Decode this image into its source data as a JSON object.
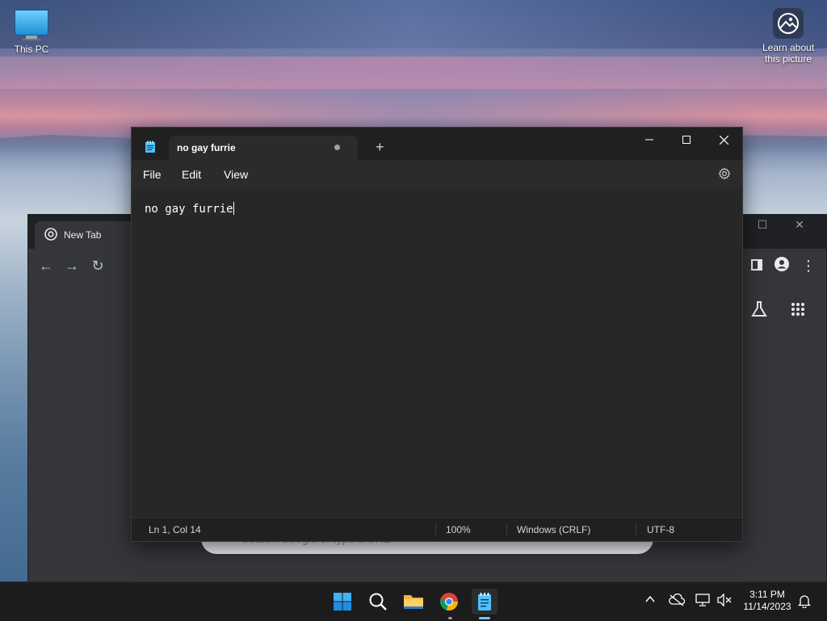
{
  "desktop": {
    "icons": [
      {
        "label": "This PC",
        "icon": "computer-icon"
      },
      {
        "label": "Learn about\nthis picture",
        "icon": "spotlight-icon"
      }
    ]
  },
  "chrome": {
    "tab_title": "New Tab",
    "search_placeholder": "Search Google or type a URL",
    "icons": [
      "chrome-logo-icon",
      "back-icon",
      "forward-icon",
      "reload-icon",
      "side-panel-icon",
      "profile-icon",
      "menu-dots-icon",
      "labs-icon",
      "apps-grid-icon"
    ]
  },
  "notepad": {
    "tab_title": "no gay furrie",
    "menu": {
      "file": "File",
      "edit": "Edit",
      "view": "View"
    },
    "content": "no gay furrie",
    "status": {
      "position": "Ln 1, Col 14",
      "zoom": "100%",
      "line_ending": "Windows (CRLF)",
      "encoding": "UTF-8"
    },
    "new_tab_symbol": "+"
  },
  "taskbar": {
    "apps": [
      "windows-start-icon",
      "search-icon",
      "file-explorer-icon",
      "chrome-icon",
      "notepad-icon"
    ],
    "active_app": "notepad-icon",
    "clock": {
      "time": "3:11 PM",
      "date": "11/14/2023"
    },
    "tray": [
      "chevron-up-icon",
      "onedrive-icon",
      "network-icon",
      "volume-muted-icon",
      "notification-bell-icon"
    ]
  },
  "colors": {
    "notepad_bg": "#272727",
    "accent": "#60cdff",
    "taskbar_bg": "#1c1c1c"
  }
}
